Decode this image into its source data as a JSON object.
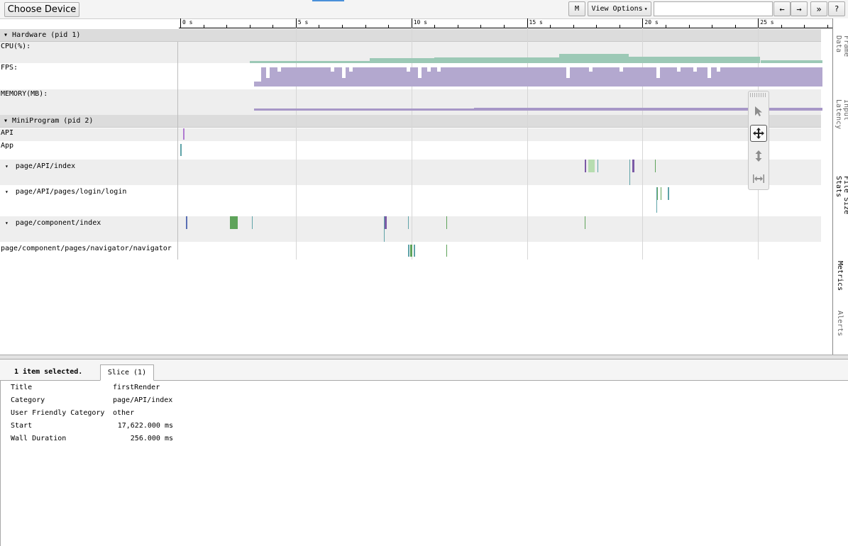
{
  "toolbar": {
    "choose_device_label": "Choose Device",
    "m_label": "M",
    "view_options_label": "View Options",
    "view_options_caret": "▾",
    "search_value": "",
    "prev_label": "←",
    "next_label": "→",
    "expand_label": "»",
    "help_label": "?"
  },
  "ruler": {
    "labels": [
      "0 s",
      "5 s",
      "10 s",
      "15 s",
      "20 s",
      "25 s"
    ]
  },
  "groups": [
    {
      "title": "Hardware (pid 1)",
      "expanded": true
    },
    {
      "title": "MiniProgram (pid 2)",
      "expanded": true
    }
  ],
  "hardware_tracks": [
    {
      "label": "CPU(%):",
      "color": "#9cc9b6"
    },
    {
      "label": "FPS:",
      "color": "#b3a8cf"
    },
    {
      "label": "MEMORY(MB):",
      "color": "#a797c7"
    }
  ],
  "mini_tracks": [
    {
      "label": "API",
      "caret": ""
    },
    {
      "label": "App",
      "caret": ""
    },
    {
      "label": "page/API/index",
      "caret": "▾"
    },
    {
      "label": "page/API/pages/login/login",
      "caret": "▾"
    },
    {
      "label": "page/component/index",
      "caret": "▾"
    },
    {
      "label": "page/component/pages/navigator/navigator",
      "caret": ""
    }
  ],
  "side_tabs": [
    "Frame\nData",
    "Input\nLatency",
    "File Size\nStats",
    "Metrics",
    "Alerts"
  ],
  "analysis": {
    "selected_label": "1 item selected.",
    "tab_label": "Slice (1)",
    "rows": [
      {
        "key": "Title",
        "value": "firstRender"
      },
      {
        "key": "Category",
        "value": "page/API/index"
      },
      {
        "key": "User Friendly Category",
        "value": "other"
      },
      {
        "key": "Start",
        "value": "17,622.000 ms"
      },
      {
        "key": "Wall Duration",
        "value": "256.000 ms"
      }
    ]
  },
  "colors": {
    "cpu": "#9cc9b6",
    "fps": "#b3a8cf",
    "memory": "#a797c7",
    "slice_green": "#5ea35a",
    "slice_light_green": "#b7ddb0",
    "slice_teal": "#5fa3a8",
    "slice_purple": "#7b5aa6",
    "slice_blue": "#5a6fb4"
  },
  "icons": [
    "selection-cursor-icon",
    "pan-move-icon",
    "zoom-vertical-icon",
    "timing-horizontal-icon"
  ]
}
